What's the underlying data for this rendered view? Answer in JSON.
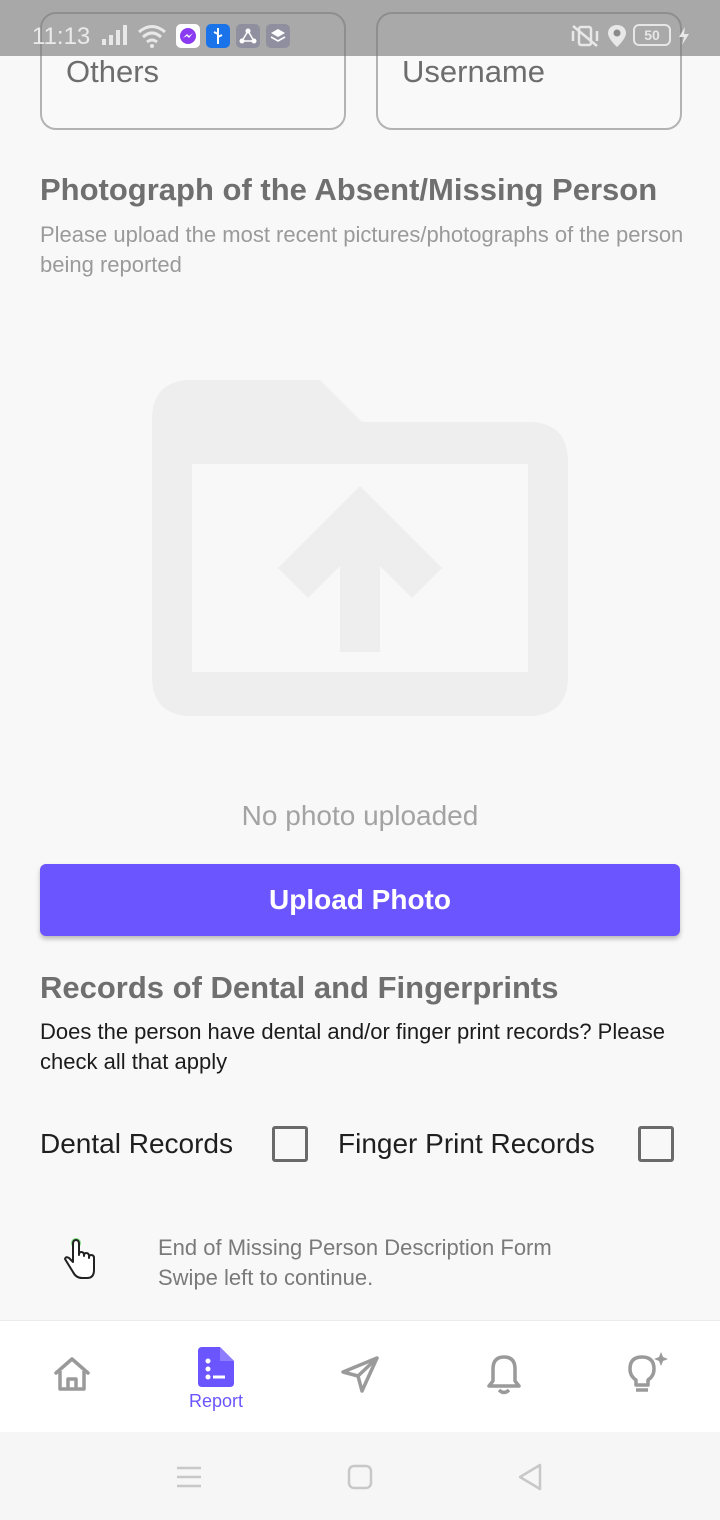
{
  "status_bar": {
    "time": "11:13",
    "battery": "50"
  },
  "top_fields": {
    "others_value": "Others",
    "username_value": "Username"
  },
  "photo_section": {
    "title": "Photograph of the Absent/Missing Person",
    "help": "Please upload the most recent pictures/photographs of the person being reported",
    "empty_state_icon": "folder-upload-icon",
    "empty_text": "No photo uploaded",
    "upload_button": "Upload Photo"
  },
  "records_section": {
    "title": "Records of Dental and Fingerprints",
    "question": "Does the person have dental and/or finger print records? Please check all that apply",
    "dental_label": "Dental Records",
    "dental_checked": false,
    "fingerprint_label": "Finger Print Records",
    "fingerprint_checked": false
  },
  "form_end": {
    "line1": "End of Missing Person Description Form",
    "line2": "Swipe left to continue."
  },
  "tab_bar": {
    "tabs": [
      {
        "icon": "home-icon",
        "label": ""
      },
      {
        "icon": "report-icon",
        "label": "Report"
      },
      {
        "icon": "send-icon",
        "label": ""
      },
      {
        "icon": "bell-icon",
        "label": ""
      },
      {
        "icon": "lightbulb-icon",
        "label": ""
      }
    ],
    "active_index": 1
  },
  "colors": {
    "accent": "#6b55fe",
    "background": "#f8f8f8"
  }
}
